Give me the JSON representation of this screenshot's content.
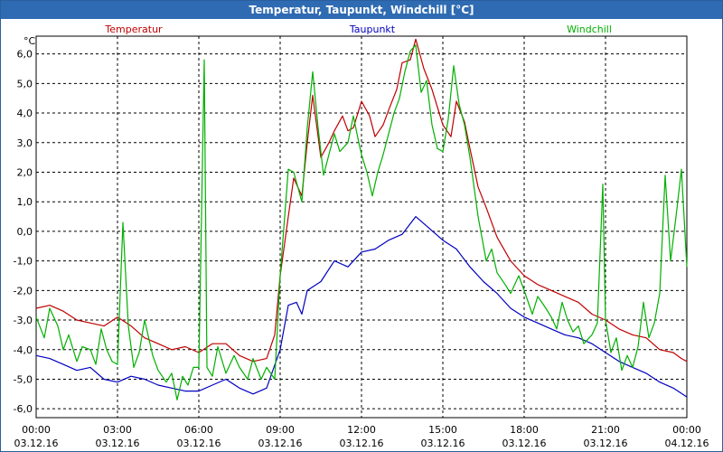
{
  "window": {
    "title": "Temperatur, Taupunkt, Windchill [°C]"
  },
  "colors": {
    "temperatur": "#c00000",
    "taupunkt": "#0000c0",
    "windchill": "#00b000",
    "grid": "#000000"
  },
  "chart_data": {
    "type": "line",
    "title": "Temperatur, Taupunkt, Windchill [°C]",
    "ylabel": "°C",
    "ylim": [
      -6.3,
      6.6
    ],
    "xlim": [
      0,
      24
    ],
    "grid": true,
    "legend_placement": "top",
    "y_ticks": [
      "6,0",
      "5,0",
      "4,0",
      "3,0",
      "2,0",
      "1,0",
      "0,0",
      "-1,0",
      "-2,0",
      "-3,0",
      "-4,0",
      "-5,0",
      "-6,0"
    ],
    "x_ticks": [
      {
        "time": "00:00",
        "date": "03.12.16"
      },
      {
        "time": "03:00",
        "date": "03.12.16"
      },
      {
        "time": "06:00",
        "date": "03.12.16"
      },
      {
        "time": "09:00",
        "date": "03.12.16"
      },
      {
        "time": "12:00",
        "date": "03.12.16"
      },
      {
        "time": "15:00",
        "date": "03.12.16"
      },
      {
        "time": "18:00",
        "date": "03.12.16"
      },
      {
        "time": "21:00",
        "date": "03.12.16"
      },
      {
        "time": "00:00",
        "date": "04.12.16"
      }
    ],
    "x_unit": "hours since 03.12.16 00:00",
    "series": [
      {
        "name": "Temperatur",
        "color": "#c00000",
        "points": [
          [
            0,
            -2.6
          ],
          [
            0.5,
            -2.5
          ],
          [
            1,
            -2.7
          ],
          [
            1.5,
            -3.0
          ],
          [
            2,
            -3.1
          ],
          [
            2.5,
            -3.2
          ],
          [
            3,
            -2.9
          ],
          [
            3.5,
            -3.2
          ],
          [
            4,
            -3.6
          ],
          [
            4.5,
            -3.8
          ],
          [
            5,
            -4.0
          ],
          [
            5.5,
            -3.9
          ],
          [
            6,
            -4.1
          ],
          [
            6.5,
            -3.8
          ],
          [
            7,
            -3.8
          ],
          [
            7.5,
            -4.2
          ],
          [
            8,
            -4.4
          ],
          [
            8.5,
            -4.3
          ],
          [
            8.8,
            -3.5
          ],
          [
            9,
            -1.5
          ],
          [
            9.3,
            0.5
          ],
          [
            9.5,
            1.8
          ],
          [
            9.8,
            1.2
          ],
          [
            10,
            3.0
          ],
          [
            10.2,
            4.6
          ],
          [
            10.5,
            2.5
          ],
          [
            10.8,
            3.0
          ],
          [
            11,
            3.4
          ],
          [
            11.3,
            3.9
          ],
          [
            11.5,
            3.4
          ],
          [
            11.7,
            3.5
          ],
          [
            12,
            4.4
          ],
          [
            12.3,
            3.9
          ],
          [
            12.5,
            3.2
          ],
          [
            12.8,
            3.6
          ],
          [
            13,
            4.1
          ],
          [
            13.3,
            4.8
          ],
          [
            13.5,
            5.7
          ],
          [
            13.8,
            5.8
          ],
          [
            14,
            6.5
          ],
          [
            14.3,
            5.5
          ],
          [
            14.6,
            4.8
          ],
          [
            15,
            3.6
          ],
          [
            15.3,
            3.2
          ],
          [
            15.5,
            4.4
          ],
          [
            15.8,
            3.7
          ],
          [
            16,
            2.8
          ],
          [
            16.3,
            1.5
          ],
          [
            16.6,
            0.8
          ],
          [
            17,
            -0.2
          ],
          [
            17.5,
            -1.0
          ],
          [
            18,
            -1.5
          ],
          [
            18.5,
            -1.8
          ],
          [
            19,
            -2.0
          ],
          [
            19.5,
            -2.2
          ],
          [
            20,
            -2.4
          ],
          [
            20.5,
            -2.8
          ],
          [
            21,
            -3.0
          ],
          [
            21.5,
            -3.3
          ],
          [
            22,
            -3.5
          ],
          [
            22.5,
            -3.6
          ],
          [
            23,
            -4.0
          ],
          [
            23.5,
            -4.1
          ],
          [
            23.8,
            -4.3
          ],
          [
            24,
            -4.4
          ]
        ]
      },
      {
        "name": "Taupunkt",
        "color": "#0000c0",
        "points": [
          [
            0,
            -4.2
          ],
          [
            0.5,
            -4.3
          ],
          [
            1,
            -4.5
          ],
          [
            1.5,
            -4.7
          ],
          [
            2,
            -4.6
          ],
          [
            2.5,
            -5.0
          ],
          [
            3,
            -5.1
          ],
          [
            3.5,
            -4.9
          ],
          [
            4,
            -5.0
          ],
          [
            4.5,
            -5.2
          ],
          [
            5,
            -5.3
          ],
          [
            5.5,
            -5.4
          ],
          [
            6,
            -5.4
          ],
          [
            6.5,
            -5.2
          ],
          [
            7,
            -5.0
          ],
          [
            7.5,
            -5.3
          ],
          [
            8,
            -5.5
          ],
          [
            8.5,
            -5.3
          ],
          [
            9,
            -4.0
          ],
          [
            9.3,
            -2.5
          ],
          [
            9.6,
            -2.4
          ],
          [
            9.8,
            -2.8
          ],
          [
            10,
            -2.0
          ],
          [
            10.5,
            -1.7
          ],
          [
            11,
            -1.0
          ],
          [
            11.5,
            -1.2
          ],
          [
            12,
            -0.7
          ],
          [
            12.5,
            -0.6
          ],
          [
            13,
            -0.3
          ],
          [
            13.5,
            -0.1
          ],
          [
            14,
            0.5
          ],
          [
            14.5,
            0.1
          ],
          [
            15,
            -0.3
          ],
          [
            15.5,
            -0.6
          ],
          [
            16,
            -1.2
          ],
          [
            16.5,
            -1.7
          ],
          [
            17,
            -2.1
          ],
          [
            17.5,
            -2.6
          ],
          [
            18,
            -2.9
          ],
          [
            18.5,
            -3.1
          ],
          [
            19,
            -3.3
          ],
          [
            19.5,
            -3.5
          ],
          [
            20,
            -3.6
          ],
          [
            20.5,
            -3.8
          ],
          [
            21,
            -4.1
          ],
          [
            21.5,
            -4.4
          ],
          [
            22,
            -4.6
          ],
          [
            22.5,
            -4.8
          ],
          [
            23,
            -5.1
          ],
          [
            23.5,
            -5.3
          ],
          [
            24,
            -5.6
          ]
        ]
      },
      {
        "name": "Windchill",
        "color": "#00b000",
        "points": [
          [
            0,
            -2.9
          ],
          [
            0.3,
            -3.6
          ],
          [
            0.5,
            -2.6
          ],
          [
            0.8,
            -3.2
          ],
          [
            1,
            -4.0
          ],
          [
            1.2,
            -3.5
          ],
          [
            1.5,
            -4.4
          ],
          [
            1.7,
            -3.9
          ],
          [
            2,
            -4.0
          ],
          [
            2.2,
            -4.5
          ],
          [
            2.4,
            -3.3
          ],
          [
            2.6,
            -4.0
          ],
          [
            2.8,
            -4.4
          ],
          [
            3,
            -4.5
          ],
          [
            3.2,
            0.3
          ],
          [
            3.4,
            -3.2
          ],
          [
            3.6,
            -4.6
          ],
          [
            3.8,
            -4.1
          ],
          [
            4,
            -3.0
          ],
          [
            4.3,
            -4.2
          ],
          [
            4.5,
            -4.7
          ],
          [
            4.8,
            -5.1
          ],
          [
            5,
            -4.8
          ],
          [
            5.2,
            -5.7
          ],
          [
            5.4,
            -4.9
          ],
          [
            5.6,
            -5.2
          ],
          [
            5.8,
            -4.6
          ],
          [
            6,
            -4.6
          ],
          [
            6.2,
            5.8
          ],
          [
            6.3,
            -4.6
          ],
          [
            6.5,
            -4.9
          ],
          [
            6.7,
            -3.9
          ],
          [
            7,
            -4.8
          ],
          [
            7.3,
            -4.2
          ],
          [
            7.5,
            -4.6
          ],
          [
            7.8,
            -5.0
          ],
          [
            8,
            -4.3
          ],
          [
            8.3,
            -5.0
          ],
          [
            8.5,
            -4.6
          ],
          [
            8.8,
            -5.0
          ],
          [
            9,
            -1.5
          ],
          [
            9.3,
            2.1
          ],
          [
            9.5,
            2.0
          ],
          [
            9.8,
            1.0
          ],
          [
            10,
            3.5
          ],
          [
            10.2,
            5.4
          ],
          [
            10.4,
            3.5
          ],
          [
            10.6,
            1.9
          ],
          [
            10.8,
            2.6
          ],
          [
            11,
            3.3
          ],
          [
            11.2,
            2.7
          ],
          [
            11.5,
            3.0
          ],
          [
            11.7,
            3.9
          ],
          [
            11.9,
            3.0
          ],
          [
            12,
            2.6
          ],
          [
            12.2,
            2.0
          ],
          [
            12.4,
            1.2
          ],
          [
            12.6,
            2.0
          ],
          [
            12.8,
            2.6
          ],
          [
            13,
            3.3
          ],
          [
            13.2,
            4.0
          ],
          [
            13.4,
            4.5
          ],
          [
            13.6,
            5.4
          ],
          [
            13.8,
            6.1
          ],
          [
            14,
            6.3
          ],
          [
            14.2,
            4.7
          ],
          [
            14.4,
            5.1
          ],
          [
            14.6,
            3.6
          ],
          [
            14.8,
            2.8
          ],
          [
            15,
            2.7
          ],
          [
            15.2,
            3.8
          ],
          [
            15.4,
            5.6
          ],
          [
            15.6,
            4.3
          ],
          [
            15.8,
            3.6
          ],
          [
            16,
            2.5
          ],
          [
            16.3,
            0.5
          ],
          [
            16.6,
            -1.0
          ],
          [
            16.8,
            -0.6
          ],
          [
            17,
            -1.4
          ],
          [
            17.3,
            -1.8
          ],
          [
            17.5,
            -2.1
          ],
          [
            17.8,
            -1.5
          ],
          [
            18,
            -2.0
          ],
          [
            18.3,
            -2.8
          ],
          [
            18.5,
            -2.2
          ],
          [
            18.8,
            -2.6
          ],
          [
            19,
            -2.9
          ],
          [
            19.2,
            -3.3
          ],
          [
            19.4,
            -2.4
          ],
          [
            19.6,
            -3.0
          ],
          [
            19.8,
            -3.4
          ],
          [
            20,
            -3.2
          ],
          [
            20.2,
            -3.8
          ],
          [
            20.5,
            -3.5
          ],
          [
            20.7,
            -3.1
          ],
          [
            20.9,
            1.6
          ],
          [
            21,
            -3.0
          ],
          [
            21.2,
            -4.1
          ],
          [
            21.4,
            -3.6
          ],
          [
            21.6,
            -4.7
          ],
          [
            21.8,
            -4.2
          ],
          [
            22,
            -4.6
          ],
          [
            22.2,
            -3.9
          ],
          [
            22.4,
            -2.4
          ],
          [
            22.6,
            -3.6
          ],
          [
            22.8,
            -3.1
          ],
          [
            23,
            -2.1
          ],
          [
            23.2,
            1.9
          ],
          [
            23.4,
            -1.0
          ],
          [
            23.6,
            0.5
          ],
          [
            23.8,
            2.1
          ],
          [
            24,
            -1.2
          ]
        ]
      }
    ]
  }
}
